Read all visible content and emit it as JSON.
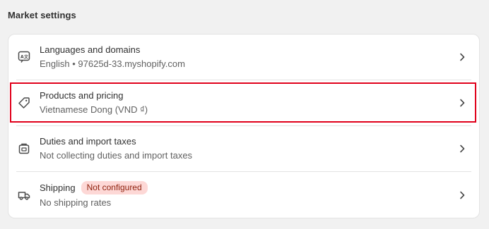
{
  "section": {
    "title": "Market settings"
  },
  "rows": [
    {
      "title": "Languages and domains",
      "subtitle": "English • 97625d-33.myshopify.com",
      "icon": "translate-icon"
    },
    {
      "title": "Products and pricing",
      "subtitle": "Vietnamese Dong (VND ₫)",
      "icon": "tag-icon"
    },
    {
      "title": "Duties and import taxes",
      "subtitle": "Not collecting duties and import taxes",
      "icon": "duties-icon"
    },
    {
      "title": "Shipping",
      "badge": "Not configured",
      "subtitle": "No shipping rates",
      "icon": "truck-icon"
    }
  ],
  "colors": {
    "highlight": "#e0001b",
    "badge_bg": "#fdd8d6",
    "badge_text": "#8e1f0b"
  }
}
